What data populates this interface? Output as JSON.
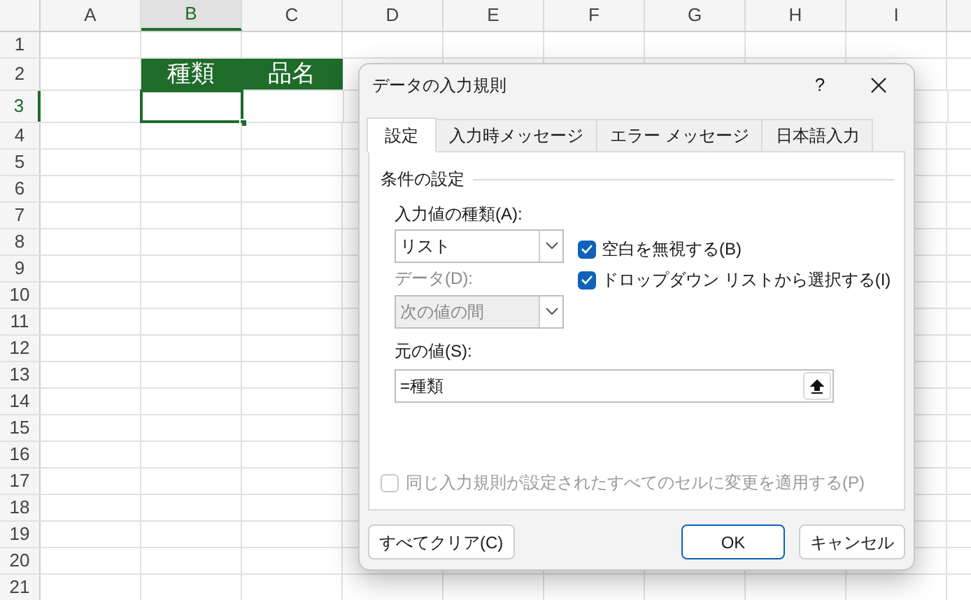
{
  "sheet": {
    "columns": [
      {
        "label": "A",
        "selected": false
      },
      {
        "label": "B",
        "selected": true
      },
      {
        "label": "C",
        "selected": false
      },
      {
        "label": "D",
        "selected": false
      },
      {
        "label": "E",
        "selected": false
      },
      {
        "label": "F",
        "selected": false
      },
      {
        "label": "G",
        "selected": false
      },
      {
        "label": "H",
        "selected": false
      },
      {
        "label": "I",
        "selected": false
      }
    ],
    "rows": [
      {
        "label": "1",
        "selected": false
      },
      {
        "label": "2",
        "selected": false,
        "cells": [
          {
            "text": "種類",
            "kind": "header"
          },
          {
            "text": "品名",
            "kind": "header"
          }
        ]
      },
      {
        "label": "3",
        "selected": true
      },
      {
        "label": "4",
        "selected": false
      },
      {
        "label": "5",
        "selected": false
      },
      {
        "label": "6",
        "selected": false
      },
      {
        "label": "7",
        "selected": false
      },
      {
        "label": "8",
        "selected": false
      },
      {
        "label": "9",
        "selected": false
      },
      {
        "label": "10",
        "selected": false
      },
      {
        "label": "11",
        "selected": false
      },
      {
        "label": "12",
        "selected": false
      },
      {
        "label": "13",
        "selected": false
      },
      {
        "label": "14",
        "selected": false
      },
      {
        "label": "15",
        "selected": false
      },
      {
        "label": "16",
        "selected": false
      },
      {
        "label": "17",
        "selected": false
      },
      {
        "label": "18",
        "selected": false
      },
      {
        "label": "19",
        "selected": false
      },
      {
        "label": "20",
        "selected": false
      },
      {
        "label": "21",
        "selected": false
      }
    ]
  },
  "dialog": {
    "title": "データの入力規則",
    "help": "?",
    "tabs": [
      {
        "label": "設定",
        "selected": true
      },
      {
        "label": "入力時メッセージ",
        "selected": false
      },
      {
        "label": "エラー メッセージ",
        "selected": false
      },
      {
        "label": "日本語入力",
        "selected": false
      }
    ],
    "section_title": "条件の設定",
    "allow": {
      "label": "入力値の種類(A):",
      "value": "リスト",
      "disabled": false
    },
    "checkboxes": [
      {
        "label": "空白を無視する(B)",
        "checked": true
      },
      {
        "label": "ドロップダウン リストから選択する(I)",
        "checked": true
      }
    ],
    "data": {
      "label": "データ(D):",
      "value": "次の値の間",
      "disabled": true
    },
    "source": {
      "label": "元の値(S):",
      "value": "=種類"
    },
    "apply_all": {
      "label": "同じ入力規則が設定されたすべてのセルに変更を適用する(P)",
      "checked": false,
      "disabled": true
    },
    "buttons": [
      {
        "label": "すべてクリア(C)",
        "kind": "secondary"
      },
      {
        "label": "OK",
        "kind": "primary"
      },
      {
        "label": "キャンセル",
        "kind": "secondary"
      }
    ]
  }
}
